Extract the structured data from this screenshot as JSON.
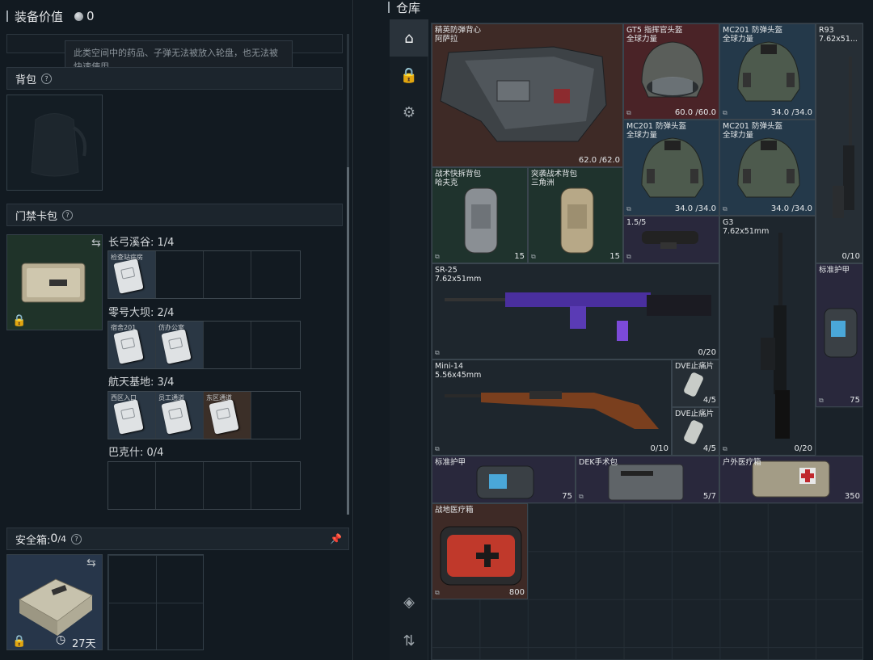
{
  "left": {
    "value_title": "装备价值",
    "value_amount": "0",
    "tooltip": "此类空间中的药品、子弹无法被放入轮盘，也无法被快速使用",
    "backpack_title": "背包",
    "keycard_title": "门禁卡包",
    "maps": [
      {
        "label": "长弓溪谷: 1/4",
        "cards": [
          "检查站病房",
          "",
          "",
          ""
        ]
      },
      {
        "label": "零号大坝: 2/4",
        "cards": [
          "宿舍201",
          "仿办公室",
          "",
          ""
        ]
      },
      {
        "label": "航天基地: 3/4",
        "cards": [
          "西区入口",
          "员工通道",
          "东区通道",
          ""
        ]
      },
      {
        "label": "巴克什: 0/4",
        "cards": [
          "",
          "",
          "",
          ""
        ]
      }
    ],
    "safebox_title": "安全箱:",
    "safebox_count": "0",
    "safebox_cap": "/4",
    "safebox_days": "27天",
    "qm": "?"
  },
  "right": {
    "title": "仓库",
    "items": {
      "vest": {
        "name": "精英防弹背心\n阿萨拉",
        "value": "62.0 /62.0"
      },
      "gt5": {
        "name": "GT5 指挥官头盔\n全球力量",
        "value": "60.0 /60.0"
      },
      "mc1": {
        "name": "MC201 防弹头盔\n全球力量",
        "value": "34.0 /34.0"
      },
      "mc2": {
        "name": "MC201 防弹头盔\n全球力量",
        "value": "34.0 /34.0"
      },
      "mc3": {
        "name": "MC201 防弹头盔\n全球力量",
        "value": "34.0 /34.0"
      },
      "r93": {
        "name": "R93\n7.62x51...",
        "value": "0/10"
      },
      "bag1": {
        "name": "战术快拆背包\n哈夫克",
        "value": "15"
      },
      "bag2": {
        "name": "突袭战术背包\n三角洲",
        "value": "15"
      },
      "scope": {
        "name": "1.5/5",
        "value": ""
      },
      "g3": {
        "name": "G3\n7.62x51mm",
        "value": "0/20"
      },
      "sr25": {
        "name": "SR-25\n7.62x51mm",
        "value": "0/20"
      },
      "armor1": {
        "name": "标准护甲",
        "value": "75"
      },
      "mini14": {
        "name": "Mini-14\n5.56x45mm",
        "value": "0/10"
      },
      "dve1": {
        "name": "DVE止痛片",
        "value": "4/5"
      },
      "dve2": {
        "name": "DVE止痛片",
        "value": "4/5"
      },
      "armor2": {
        "name": "标准护甲",
        "value": "75"
      },
      "dek": {
        "name": "DEK手术包",
        "value": "5/7"
      },
      "outdoor": {
        "name": "户外医疗箱",
        "value": "350"
      },
      "field": {
        "name": "战地医疗箱",
        "value": "800"
      }
    }
  }
}
